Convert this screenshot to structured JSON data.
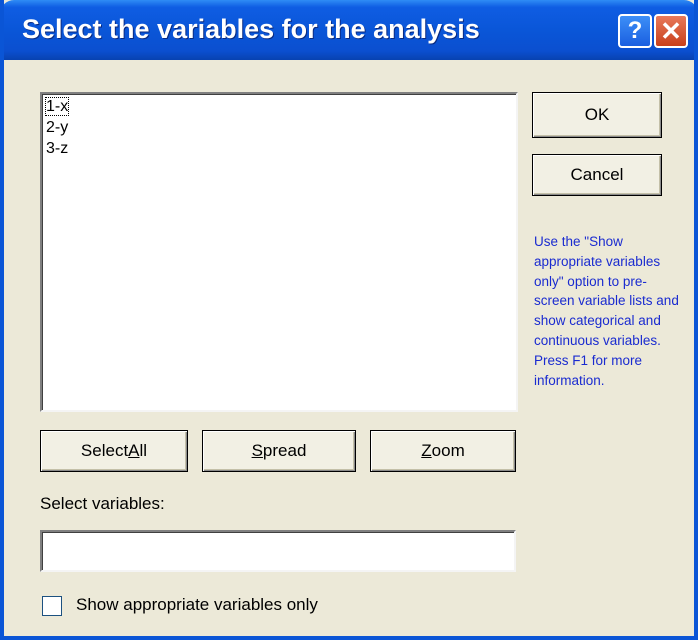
{
  "window": {
    "title": "Select the variables for the analysis",
    "help_glyph": "?",
    "close_glyph": "✕"
  },
  "variables": {
    "items": [
      "1-x",
      "2-y",
      "3-z"
    ],
    "focused_index": 0
  },
  "buttons": {
    "ok": "OK",
    "cancel": "Cancel",
    "select_all": {
      "before": "Select ",
      "accel": "A",
      "after": "ll"
    },
    "spread": {
      "before": "",
      "accel": "S",
      "after": "pread"
    },
    "zoom": {
      "before": "",
      "accel": "Z",
      "after": "oom"
    }
  },
  "hint_text": "Use the \"Show appropriate variables only\" option to pre-screen variable lists and show categorical and continuous variables. Press F1 for more information.",
  "select_label": "Select variables:",
  "select_input": {
    "value": "",
    "placeholder": ""
  },
  "checkbox": {
    "label": "Show appropriate variables only",
    "checked": false
  },
  "colors": {
    "titlebar": "#0a56d8",
    "dialog_bg": "#ece9d8",
    "hint_text": "#1a2bd0",
    "close_button": "#c8401c"
  },
  "icons": {
    "help": "help-icon",
    "close": "close-icon"
  }
}
